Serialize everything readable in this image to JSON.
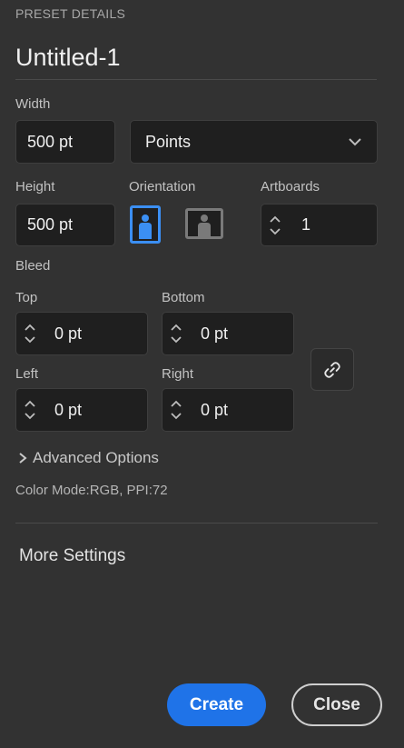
{
  "panel": {
    "section_title": "PRESET DETAILS",
    "preset_name": "Untitled-1"
  },
  "width": {
    "label": "Width",
    "value": "500 pt"
  },
  "units": {
    "selected": "Points"
  },
  "height": {
    "label": "Height",
    "value": "500 pt"
  },
  "orientation": {
    "label": "Orientation",
    "selected": "portrait"
  },
  "artboards": {
    "label": "Artboards",
    "value": "1"
  },
  "bleed": {
    "label": "Bleed",
    "top": {
      "label": "Top",
      "value": "0 pt"
    },
    "bottom": {
      "label": "Bottom",
      "value": "0 pt"
    },
    "left": {
      "label": "Left",
      "value": "0 pt"
    },
    "right": {
      "label": "Right",
      "value": "0 pt"
    }
  },
  "advanced": {
    "label": "Advanced Options"
  },
  "color_info": "Color Mode:RGB, PPI:72",
  "more_settings": "More Settings",
  "buttons": {
    "create": "Create",
    "close": "Close"
  },
  "colors": {
    "accent": "#1f73e8",
    "selected_orientation": "#3b8ff3",
    "background": "#323232"
  }
}
